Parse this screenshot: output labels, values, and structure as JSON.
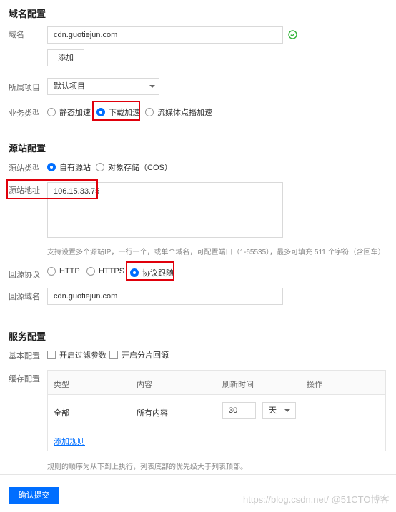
{
  "domain_section": {
    "title": "域名配置",
    "domain_label": "域名",
    "domain_value": "cdn.guotiejun.com",
    "add_button": "添加",
    "project_label": "所属项目",
    "project_value": "默认项目",
    "business_label": "业务类型",
    "business_options": [
      "静态加速",
      "下载加速",
      "流媒体点播加速"
    ],
    "business_selected": "下载加速"
  },
  "origin_section": {
    "title": "源站配置",
    "origin_type_label": "源站类型",
    "origin_type_options": [
      "自有源站",
      "对象存储（COS）"
    ],
    "origin_type_selected": "自有源站",
    "origin_addr_label": "源站地址",
    "origin_addr_value": "106.15.33.75",
    "origin_addr_hint": "支持设置多个源站IP，一行一个，或单个域名，可配置端口（1-65535），最多可填充 511 个字符（含回车）",
    "protocol_label": "回源协议",
    "protocol_options": [
      "HTTP",
      "HTTPS",
      "协议跟随"
    ],
    "protocol_selected": "协议跟随",
    "origin_domain_label": "回源域名",
    "origin_domain_value": "cdn.guotiejun.com"
  },
  "service_section": {
    "title": "服务配置",
    "basic_label": "基本配置",
    "basic_options": [
      "开启过滤参数",
      "开启分片回源"
    ],
    "cache_label": "缓存配置",
    "table_headers": [
      "类型",
      "内容",
      "刷新时间",
      "操作"
    ],
    "table_row": {
      "type": "全部",
      "content": "所有内容",
      "time_value": "30",
      "time_unit": "天"
    },
    "add_rule_link": "添加规则",
    "rule_hint": "规则的顺序为从下到上执行，列表底部的优先级大于列表顶部。"
  },
  "submit_button": "确认提交",
  "watermark": "https://blog.csdn.net/  @51CTO博客",
  "colors": {
    "accent": "#006eff",
    "highlight_box": "#e0000b",
    "success": "#34b53a"
  }
}
